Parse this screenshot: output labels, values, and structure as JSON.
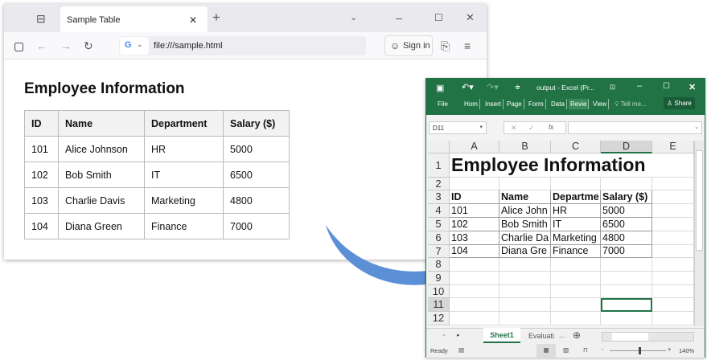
{
  "browser": {
    "tab_title": "Sample Table",
    "url": "file:///sample.html",
    "sign_in": "Sign in",
    "page": {
      "heading": "Employee Information",
      "table": {
        "headers": [
          "ID",
          "Name",
          "Department",
          "Salary ($)"
        ],
        "rows": [
          [
            "101",
            "Alice Johnson",
            "HR",
            "5000"
          ],
          [
            "102",
            "Bob Smith",
            "IT",
            "6500"
          ],
          [
            "103",
            "Charlie Davis",
            "Marketing",
            "4800"
          ],
          [
            "104",
            "Diana Green",
            "Finance",
            "7000"
          ]
        ]
      }
    }
  },
  "excel": {
    "title": "output - Excel (Pr...",
    "ribbon_tabs": [
      "File",
      "Hom",
      "Insert",
      "Page",
      "Form",
      "Data",
      "Revie",
      "View"
    ],
    "tell_me": "Tell me...",
    "share": "Share",
    "name_box": "D11",
    "fx": "fx",
    "columns": [
      "A",
      "B",
      "C",
      "D",
      "E"
    ],
    "row_numbers": [
      "1",
      "2",
      "3",
      "4",
      "5",
      "6",
      "7",
      "8",
      "9",
      "10",
      "11",
      "12"
    ],
    "title_cell": "Employee Information",
    "cells": [
      [
        "ID",
        "Name",
        "Departme",
        "Salary ($)"
      ],
      [
        "101",
        "Alice John",
        "HR",
        "5000"
      ],
      [
        "102",
        "Bob Smith",
        "IT",
        "6500"
      ],
      [
        "103",
        "Charlie Da",
        "Marketing",
        "4800"
      ],
      [
        "104",
        "Diana Gre",
        "Finance",
        "7000"
      ]
    ],
    "sheets": [
      "Sheet1",
      "Evaluati"
    ],
    "more_sheets": "...",
    "status": "Ready",
    "zoom": "140%",
    "accent": "#217346",
    "selected_cell": "D11"
  },
  "arrow_color": "#5b8fd6"
}
